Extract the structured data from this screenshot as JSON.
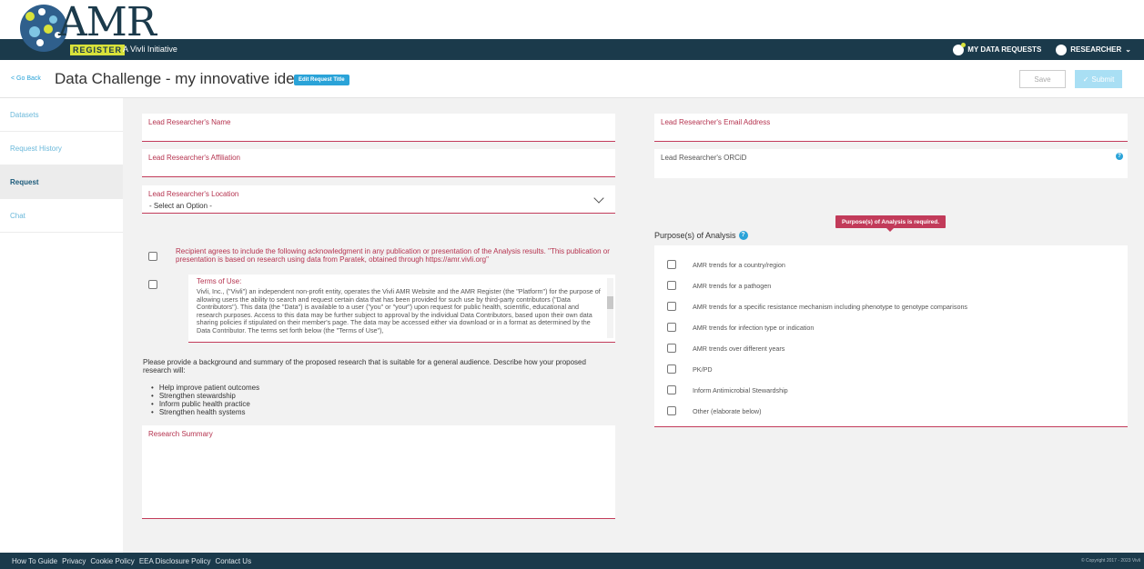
{
  "header": {
    "logo_word": "AMR",
    "logo_register": "REGISTER",
    "logo_subtitle": "A Vivli Initiative",
    "my_data_requests": "MY DATA REQUESTS",
    "researcher": "RESEARCHER"
  },
  "titlebar": {
    "go_back": "< Go Back",
    "title": "Data Challenge - my innovative idea",
    "edit_title": "Edit Request Title",
    "save": "Save",
    "submit": "Submit"
  },
  "sidebar": {
    "items": [
      {
        "label": "Datasets"
      },
      {
        "label": "Request History"
      },
      {
        "label": "Request"
      },
      {
        "label": "Chat"
      }
    ]
  },
  "form": {
    "lead_name": "Lead Researcher's Name",
    "lead_email": "Lead Researcher's Email Address",
    "lead_affiliation": "Lead Researcher's Affiliation",
    "lead_orcid": "Lead Researcher's ORCiD",
    "lead_location": "Lead Researcher's Location",
    "location_value": "- Select an Option -",
    "acknowledgment": "Recipient agrees to include the following acknowledgment in any publication or presentation of the Analysis results. \"This publication or presentation is based on research using data from Paratek, obtained through https://amr.vivli.org\"",
    "terms_title": "Terms of Use:",
    "terms_body": "Vivli, Inc., (\"Vivli\") an independent non-profit entity, operates the Vivli AMR Website and the AMR Register (the \"Platform\") for the purpose of allowing users the ability to search and request certain data that has been provided for such use by third-party contributors (\"Data Contributors\"). This data (the \"Data\") is available to a user (\"you\" or \"your\") upon request for public health, scientific, educational and research purposes. Access to this data may be further subject to approval by the individual Data Contributors, based upon their own data sharing policies if stipulated on their member's page. The data may be accessed either via download or in a format as determined by the Data Contributor. The terms set forth below (the \"Terms of Use\"),",
    "provide_text": "Please provide a background and summary of the proposed research that is suitable for a general audience. Describe how your proposed research will:",
    "bullets": [
      "Help improve patient outcomes",
      "Strengthen stewardship",
      "Inform public health practice",
      "Strengthen health systems"
    ],
    "research_summary": "Research Summary"
  },
  "purpose": {
    "label": "Purpose(s) of Analysis",
    "error": "Purpose(s) of Analysis is required.",
    "options": [
      "AMR trends for a country/region",
      "AMR trends for a pathogen",
      "AMR trends for a specific resistance mechanism including phenotype to genotype comparisons",
      "AMR trends for infection type or indication",
      "AMR trends over different years",
      "PK/PD",
      "Inform Antimicrobial Stewardship",
      "Other (elaborate below)"
    ]
  },
  "footer": {
    "links": [
      "How To Guide",
      "Privacy",
      "Cookie Policy",
      "EEA Disclosure Policy",
      "Contact Us"
    ],
    "copyright": "© Copyright 2017 - 2023 Vivli"
  },
  "colors": {
    "navbar": "#1b3a4b",
    "accent": "#2aa3d8",
    "required": "#c23b5a"
  }
}
